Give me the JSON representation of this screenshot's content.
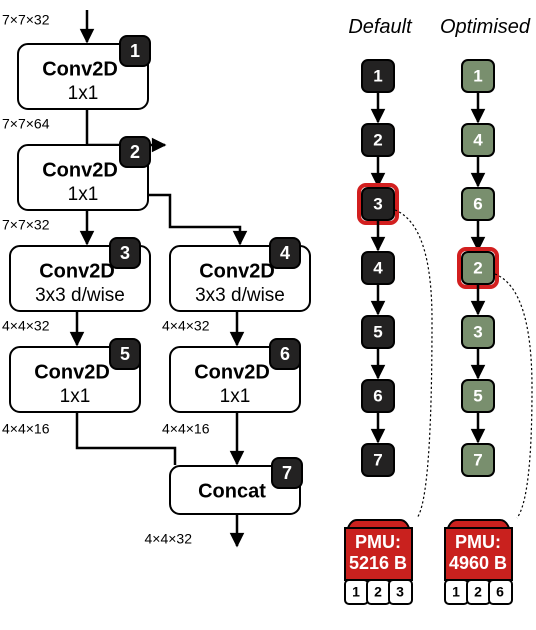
{
  "graph": {
    "input_shape": "7×7×32",
    "ops": [
      {
        "id": 1,
        "name": "Conv2D",
        "kernel": "1x1",
        "out_shape": "7×7×64"
      },
      {
        "id": 2,
        "name": "Conv2D",
        "kernel": "1x1",
        "out_shape": "7×7×32"
      },
      {
        "id": 3,
        "name": "Conv2D",
        "kernel": "3x3 d/wise",
        "out_shape": "4×4×32"
      },
      {
        "id": 4,
        "name": "Conv2D",
        "kernel": "3x3 d/wise",
        "out_shape": "4×4×32"
      },
      {
        "id": 5,
        "name": "Conv2D",
        "kernel": "1x1",
        "out_shape": "4×4×16"
      },
      {
        "id": 6,
        "name": "Conv2D",
        "kernel": "1x1",
        "out_shape": "4×4×16"
      },
      {
        "id": 7,
        "name": "Concat",
        "kernel": "",
        "out_shape": "4×4×32"
      }
    ]
  },
  "columns": {
    "default": {
      "header": "Default",
      "order": [
        "1",
        "2",
        "3",
        "4",
        "5",
        "6",
        "7"
      ],
      "highlight_index": 2,
      "pmu_label": "PMU:",
      "pmu_value": "5216 B",
      "tensors": [
        "1",
        "2",
        "3"
      ]
    },
    "optimised": {
      "header": "Optimised",
      "order": [
        "1",
        "4",
        "6",
        "2",
        "3",
        "5",
        "7"
      ],
      "highlight_index": 3,
      "pmu_label": "PMU:",
      "pmu_value": "4960 B",
      "tensors": [
        "1",
        "2",
        "6"
      ]
    }
  }
}
